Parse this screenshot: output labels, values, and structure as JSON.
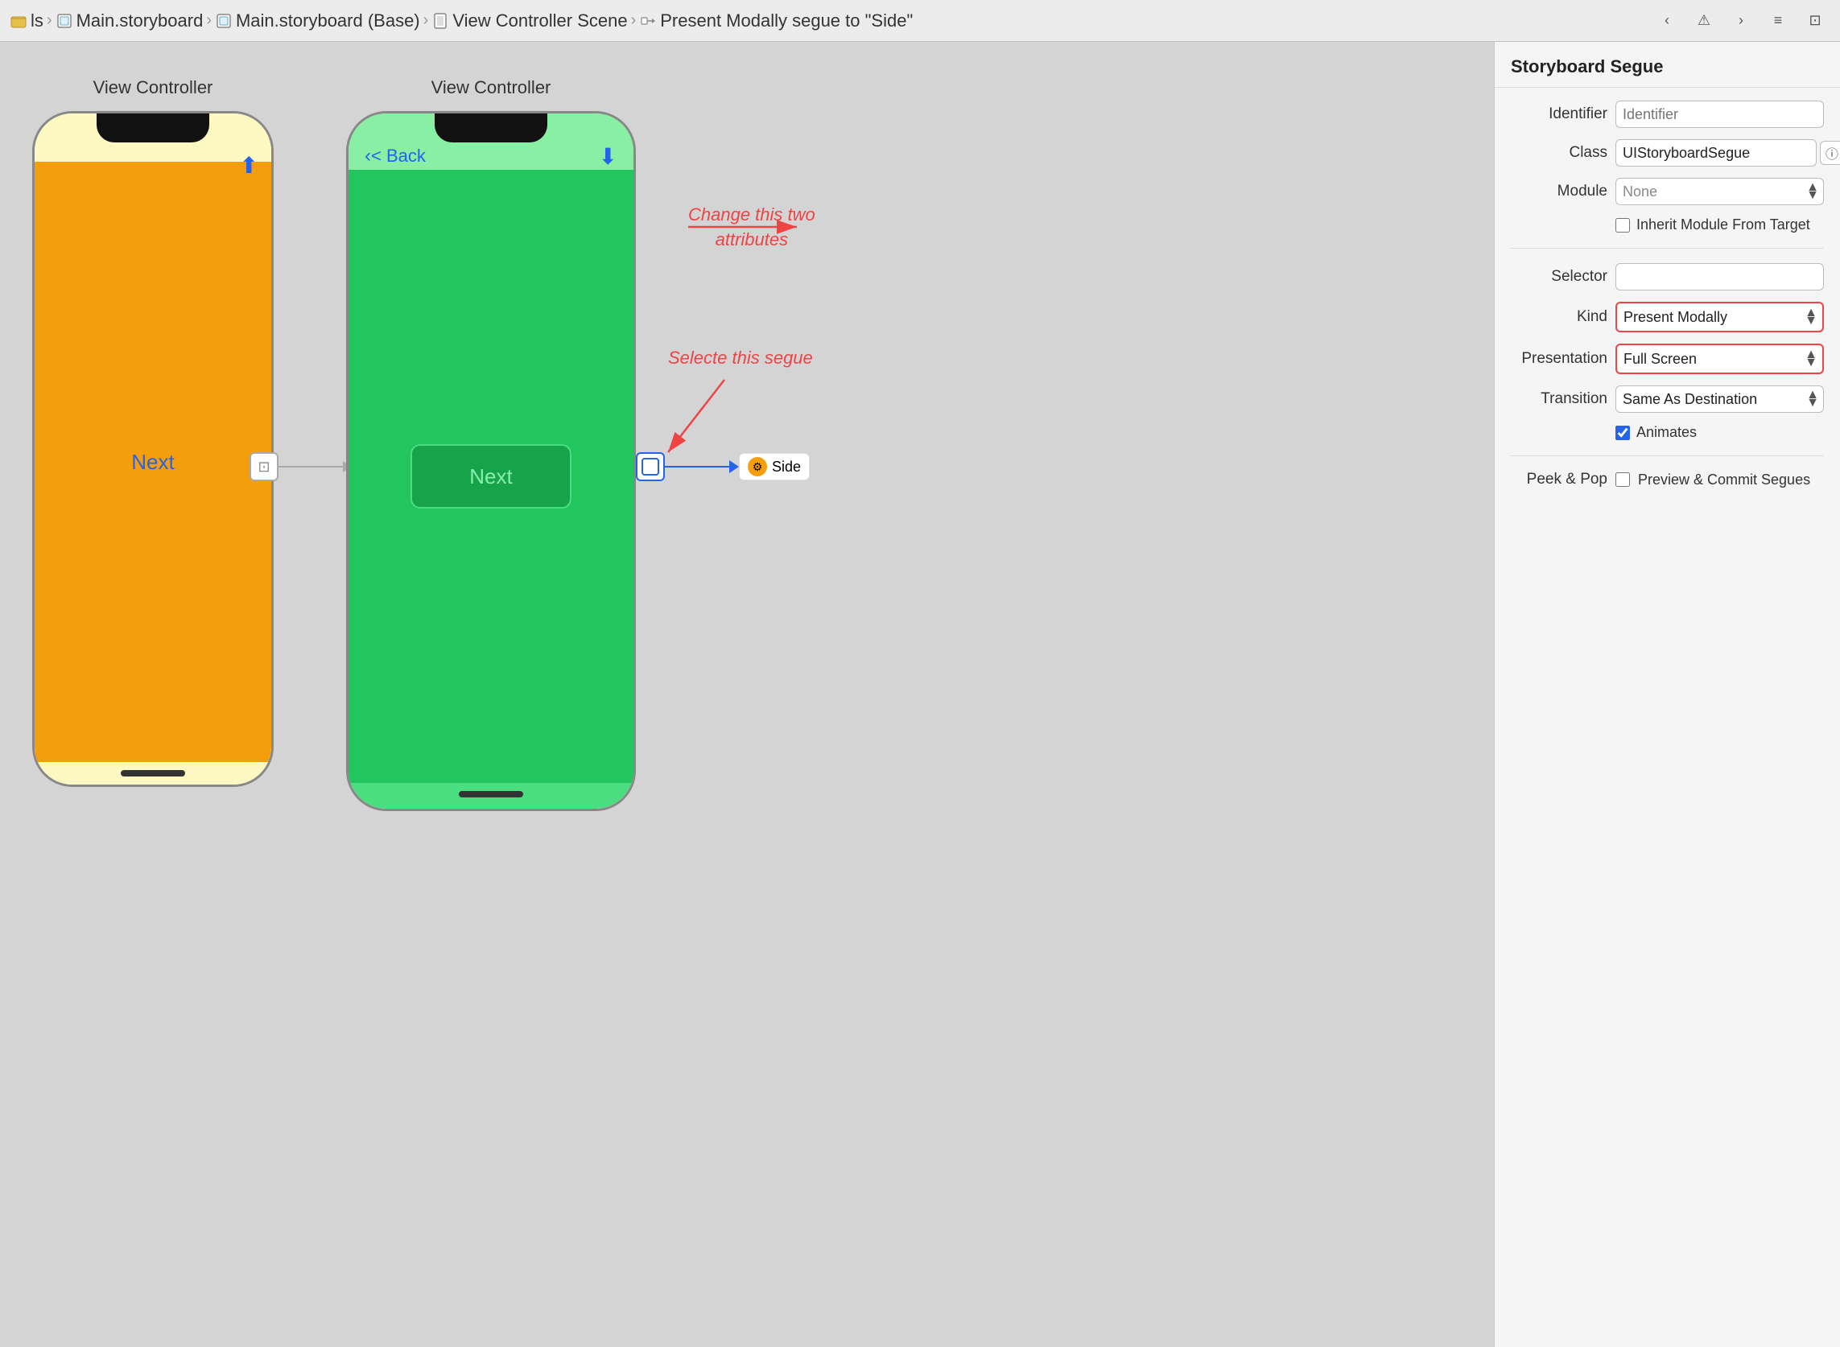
{
  "topbar": {
    "breadcrumbs": [
      {
        "label": "ls",
        "icon": "folder"
      },
      {
        "label": "Main.storyboard",
        "icon": "storyboard"
      },
      {
        "label": "Main.storyboard (Base)",
        "icon": "storyboard"
      },
      {
        "label": "View Controller Scene",
        "icon": "scene"
      },
      {
        "label": "Present Modally segue to \"Side\"",
        "icon": "segue"
      }
    ],
    "sep": "›"
  },
  "canvas": {
    "phone1": {
      "label": "View Controller",
      "next_text": "Next",
      "background_top": "#fef9c3",
      "background_bottom": "#f59e0b"
    },
    "phone2": {
      "label": "View Controller",
      "back_text": "< Back",
      "next_text": "Next",
      "background": "#22c55e"
    },
    "segue_dest": "Side",
    "annotation1": "Change this two\nattributes",
    "annotation2": "Selecte this segue"
  },
  "right_panel": {
    "title": "Storyboard Segue",
    "fields": {
      "identifier_label": "Identifier",
      "identifier_placeholder": "Identifier",
      "class_label": "Class",
      "class_value": "UIStoryboardSegue",
      "module_label": "Module",
      "module_value": "None",
      "inherit_label": "Inherit Module From Target",
      "selector_label": "Selector",
      "kind_label": "Kind",
      "kind_value": "Present Modally",
      "presentation_label": "Presentation",
      "presentation_value": "Full Screen",
      "transition_label": "Transition",
      "transition_value": "Same As Destination",
      "animates_label": "Animates",
      "peek_label": "Peek & Pop",
      "preview_label": "Preview & Commit Segues"
    }
  }
}
